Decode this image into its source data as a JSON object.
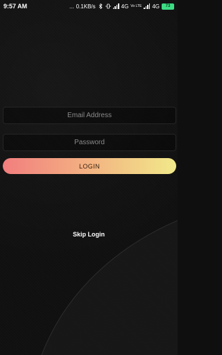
{
  "status_bar": {
    "time": "9:57 AM",
    "dots": "...",
    "speed": "0.1KB/s",
    "net1": "4G",
    "net2": "4G",
    "volte": "Vo LTE",
    "battery": "73"
  },
  "form": {
    "email_placeholder": "Email Address",
    "password_placeholder": "Password",
    "login_label": "LOGIN"
  },
  "skip_label": "Skip Login",
  "colors": {
    "login_gradient_start": "#f27e7e",
    "login_gradient_end": "#f1e98a",
    "background": "#101010",
    "battery": "#3ddc84"
  }
}
